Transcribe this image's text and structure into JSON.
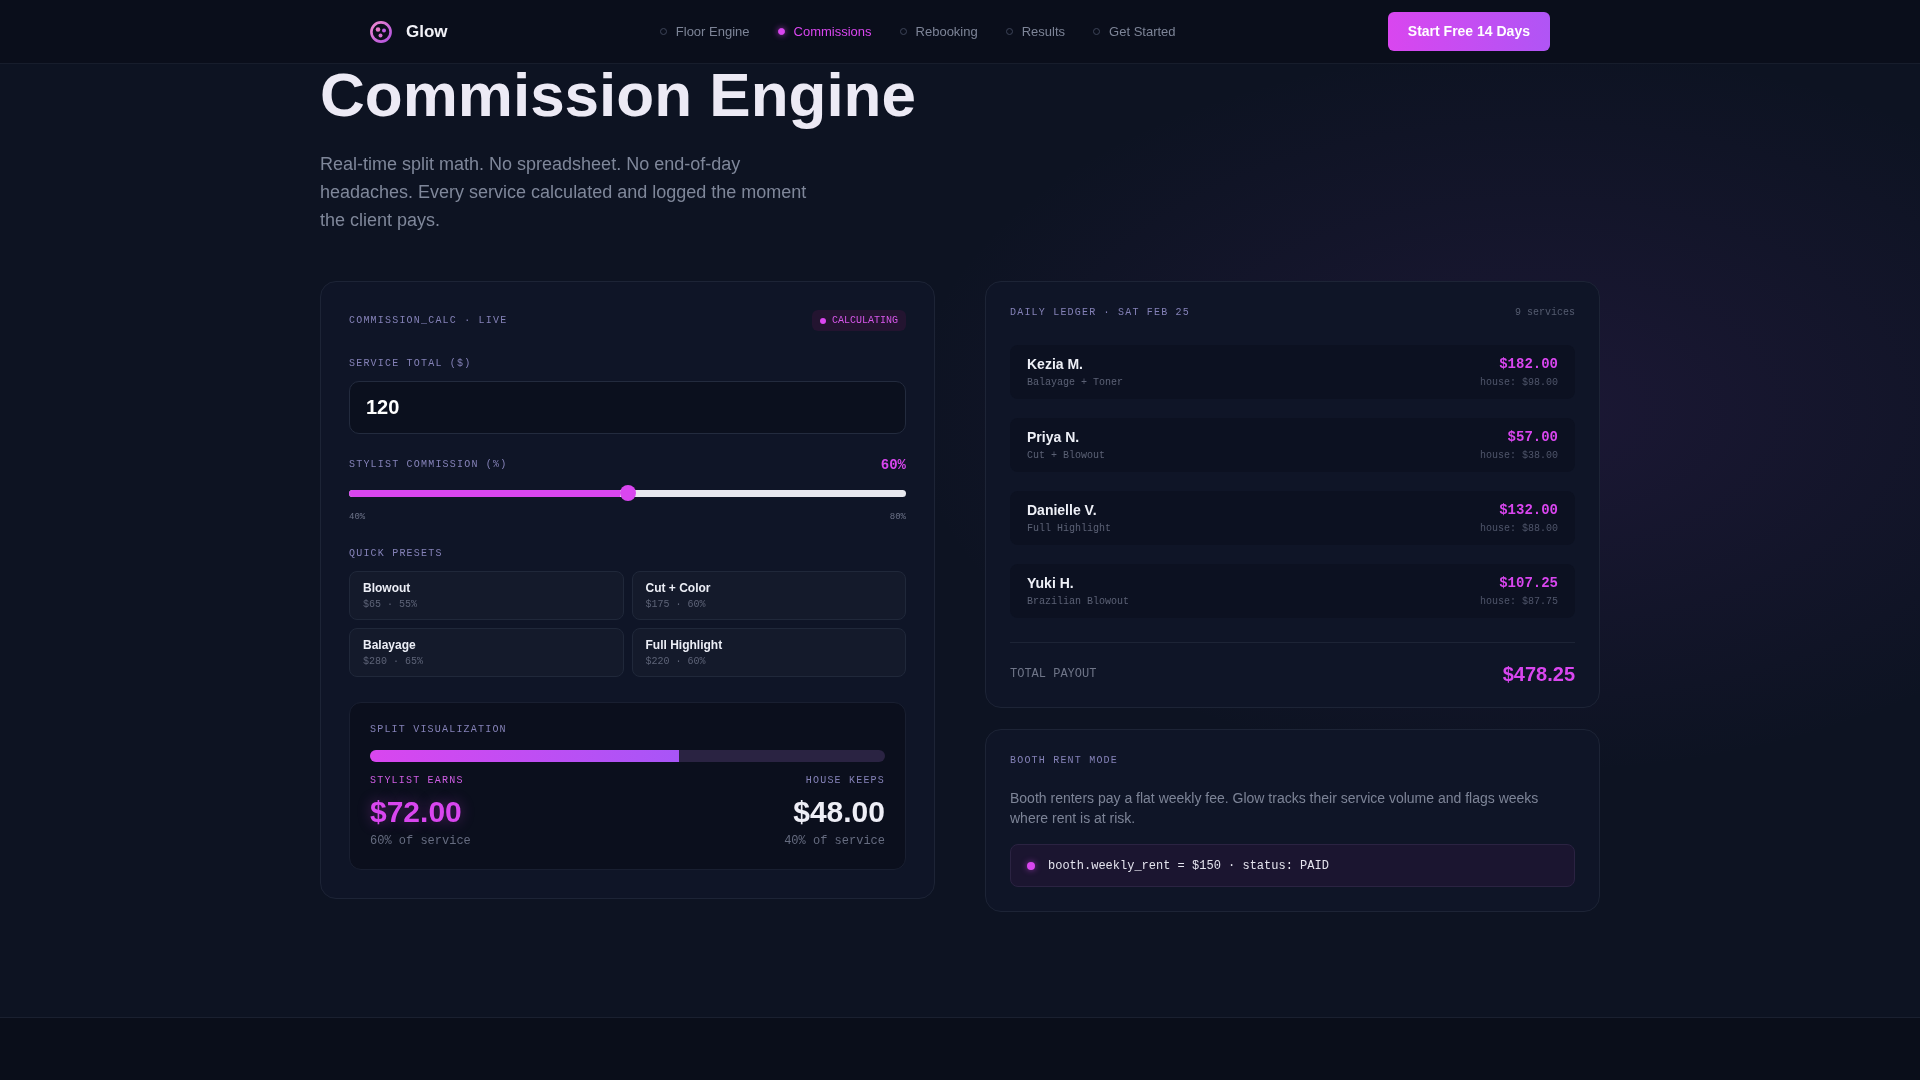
{
  "navbar": {
    "brand": "Glow",
    "links": [
      {
        "label": "Floor Engine",
        "selected": false
      },
      {
        "label": "Commissions",
        "selected": true
      },
      {
        "label": "Rebooking",
        "selected": false
      },
      {
        "label": "Results",
        "selected": false
      },
      {
        "label": "Get Started",
        "selected": false
      }
    ],
    "cta": "Start Free 14 Days"
  },
  "hero": {
    "title": "Commission Engine",
    "description": "Real-time split math. No spreadsheet. No end-of-day headaches. Every service calculated and logged the moment the client pays."
  },
  "calculator": {
    "header": "COMMISSION_CALC · LIVE",
    "badge": "CALCULATING",
    "service_total": {
      "label": "SERVICE TOTAL ($)",
      "value": "120"
    },
    "commission": {
      "label": "STYLIST COMMISSION (%)",
      "reading": "60%",
      "level": 0.5,
      "min_label": "40%",
      "max_label": "80%"
    },
    "presets_label": "QUICK PRESETS",
    "presets": [
      {
        "name": "Blowout",
        "detail": "$65 · 55%"
      },
      {
        "name": "Cut + Color",
        "detail": "$175 · 60%"
      },
      {
        "name": "Balayage",
        "detail": "$280 · 65%"
      },
      {
        "name": "Full Highlight",
        "detail": "$220 · 60%"
      }
    ],
    "split": {
      "label": "SPLIT VISUALIZATION",
      "level": 0.6,
      "stylist": {
        "label": "STYLIST EARNS",
        "amount": "$72.00",
        "share": "60% of service"
      },
      "house": {
        "label": "HOUSE KEEPS",
        "amount": "$48.00",
        "share": "40% of service"
      }
    }
  },
  "ledger": {
    "title": "DAILY LEDGER · SAT FEB 25",
    "count": "9 services",
    "rows": [
      {
        "name": "Kezia M.",
        "service": "Balayage + Toner",
        "amount": "$182.00",
        "house": "house: $98.00"
      },
      {
        "name": "Priya N.",
        "service": "Cut + Blowout",
        "amount": "$57.00",
        "house": "house: $38.00"
      },
      {
        "name": "Danielle V.",
        "service": "Full Highlight",
        "amount": "$132.00",
        "house": "house: $88.00"
      },
      {
        "name": "Yuki H.",
        "service": "Brazilian Blowout",
        "amount": "$107.25",
        "house": "house: $87.75"
      }
    ],
    "total_label": "TOTAL PAYOUT",
    "total": "$478.25"
  },
  "booth": {
    "title": "BOOTH RENT MODE",
    "description": "Booth renters pay a flat weekly fee. Glow tracks their service volume and flags weeks where rent is at risk.",
    "code": "booth.weekly_rent = $150 · status: PAID"
  }
}
